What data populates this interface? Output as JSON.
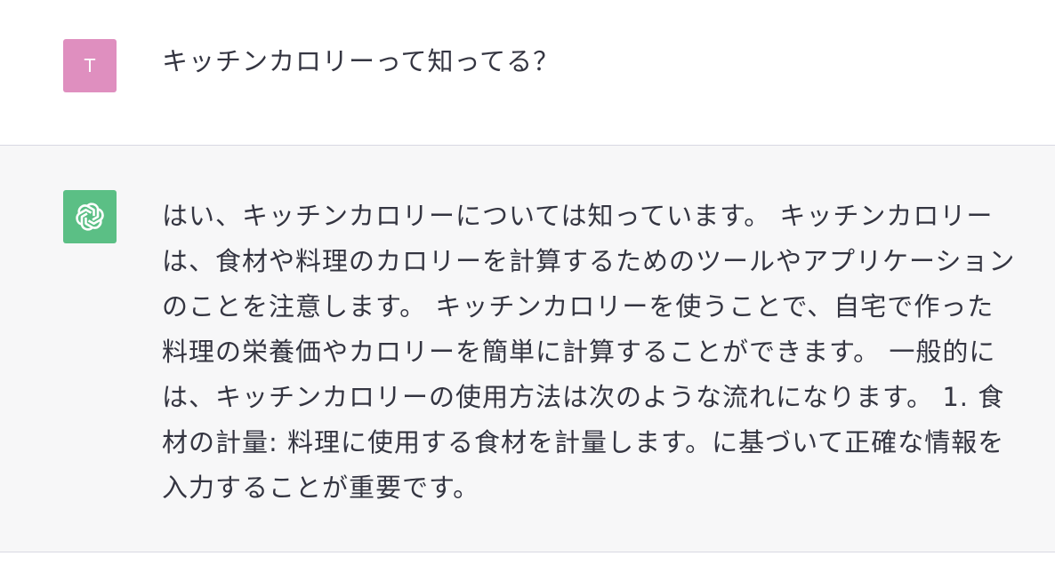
{
  "user_turn": {
    "avatar_initial": "T",
    "message": "キッチンカロリーって知ってる？"
  },
  "assistant_turn": {
    "avatar_icon": "openai-logo-icon",
    "message": "はい、キッチンカロリーについては知っています。 キッチンカロリーは、食材や料理のカロリーを計算するためのツールやアプリケーションのことを注意します。 キッチンカロリーを使うことで、自宅で作った料理の栄養価やカロリーを簡単に計算することができます。 一般的には、キッチンカロリーの使用方法は次のような流れになります。 1. 食材の計量: 料理に使用する食材を計量します。に基づいて正確な情報を入力することが重要です。"
  },
  "colors": {
    "user_avatar": "#df8fbf",
    "assistant_avatar": "#5bbf85",
    "assistant_bg": "#f7f7f8",
    "text": "#343541"
  }
}
